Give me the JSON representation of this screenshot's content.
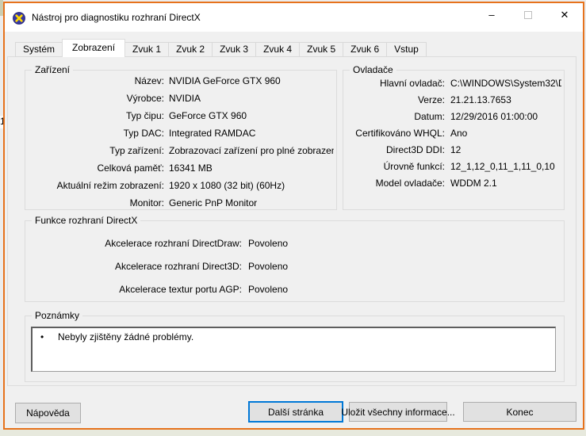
{
  "background": {
    "partial_text": "1"
  },
  "window": {
    "title": "Nástroj pro diagnostiku rozhraní DirectX",
    "controls": {
      "minimize": "–",
      "close": "✕"
    }
  },
  "colors": {
    "window_border": "#e6721c",
    "focus_blue": "#0078d7",
    "dialog_bg": "#f0f0f0",
    "titlebar_bg": "#ffffff"
  },
  "tabs": {
    "active_tab": "Zobrazení",
    "items": [
      {
        "label": "Systém"
      },
      {
        "label": "Zobrazení"
      },
      {
        "label": "Zvuk 1"
      },
      {
        "label": "Zvuk 2"
      },
      {
        "label": "Zvuk 3"
      },
      {
        "label": "Zvuk 4"
      },
      {
        "label": "Zvuk 5"
      },
      {
        "label": "Zvuk 6"
      },
      {
        "label": "Vstup"
      }
    ]
  },
  "device": {
    "legend": "Zařízení",
    "rows": [
      {
        "label": "Název:",
        "value": "NVIDIA GeForce GTX 960"
      },
      {
        "label": "Výrobce:",
        "value": "NVIDIA"
      },
      {
        "label": "Typ čipu:",
        "value": "GeForce GTX 960"
      },
      {
        "label": "Typ DAC:",
        "value": "Integrated RAMDAC"
      },
      {
        "label": "Typ zařízení:",
        "value": "Zobrazovací zařízení pro plné zobrazení"
      },
      {
        "label": "Celková paměť:",
        "value": "16341 MB"
      },
      {
        "label": "Aktuální režim zobrazení:",
        "value": "1920 x 1080 (32 bit) (60Hz)"
      },
      {
        "label": "Monitor:",
        "value": "Generic PnP Monitor"
      }
    ]
  },
  "drivers": {
    "legend": "Ovladače",
    "rows": [
      {
        "label": "Hlavní ovladač:",
        "value": "C:\\WINDOWS\\System32\\D"
      },
      {
        "label": "Verze:",
        "value": "21.21.13.7653"
      },
      {
        "label": "Datum:",
        "value": "12/29/2016 01:00:00"
      },
      {
        "label": "Certifikováno WHQL:",
        "value": "Ano"
      },
      {
        "label": "Direct3D DDI:",
        "value": "12"
      },
      {
        "label": "Úrovně funkcí:",
        "value": "12_1,12_0,11_1,11_0,10"
      },
      {
        "label": "Model ovladače:",
        "value": "WDDM 2.1"
      }
    ]
  },
  "features": {
    "legend": "Funkce rozhraní DirectX",
    "rows": [
      {
        "label": "Akcelerace rozhraní DirectDraw:",
        "value": "Povoleno"
      },
      {
        "label": "Akcelerace rozhraní Direct3D:",
        "value": "Povoleno"
      },
      {
        "label": "Akcelerace textur portu AGP:",
        "value": "Povoleno"
      }
    ]
  },
  "notes": {
    "legend": "Poznámky",
    "bullet": "•",
    "items": [
      "Nebyly zjištěny žádné problémy."
    ]
  },
  "buttons": {
    "help": "Nápověda",
    "next": "Další stránka",
    "save": "Uložit všechny informace...",
    "exit": "Konec"
  }
}
